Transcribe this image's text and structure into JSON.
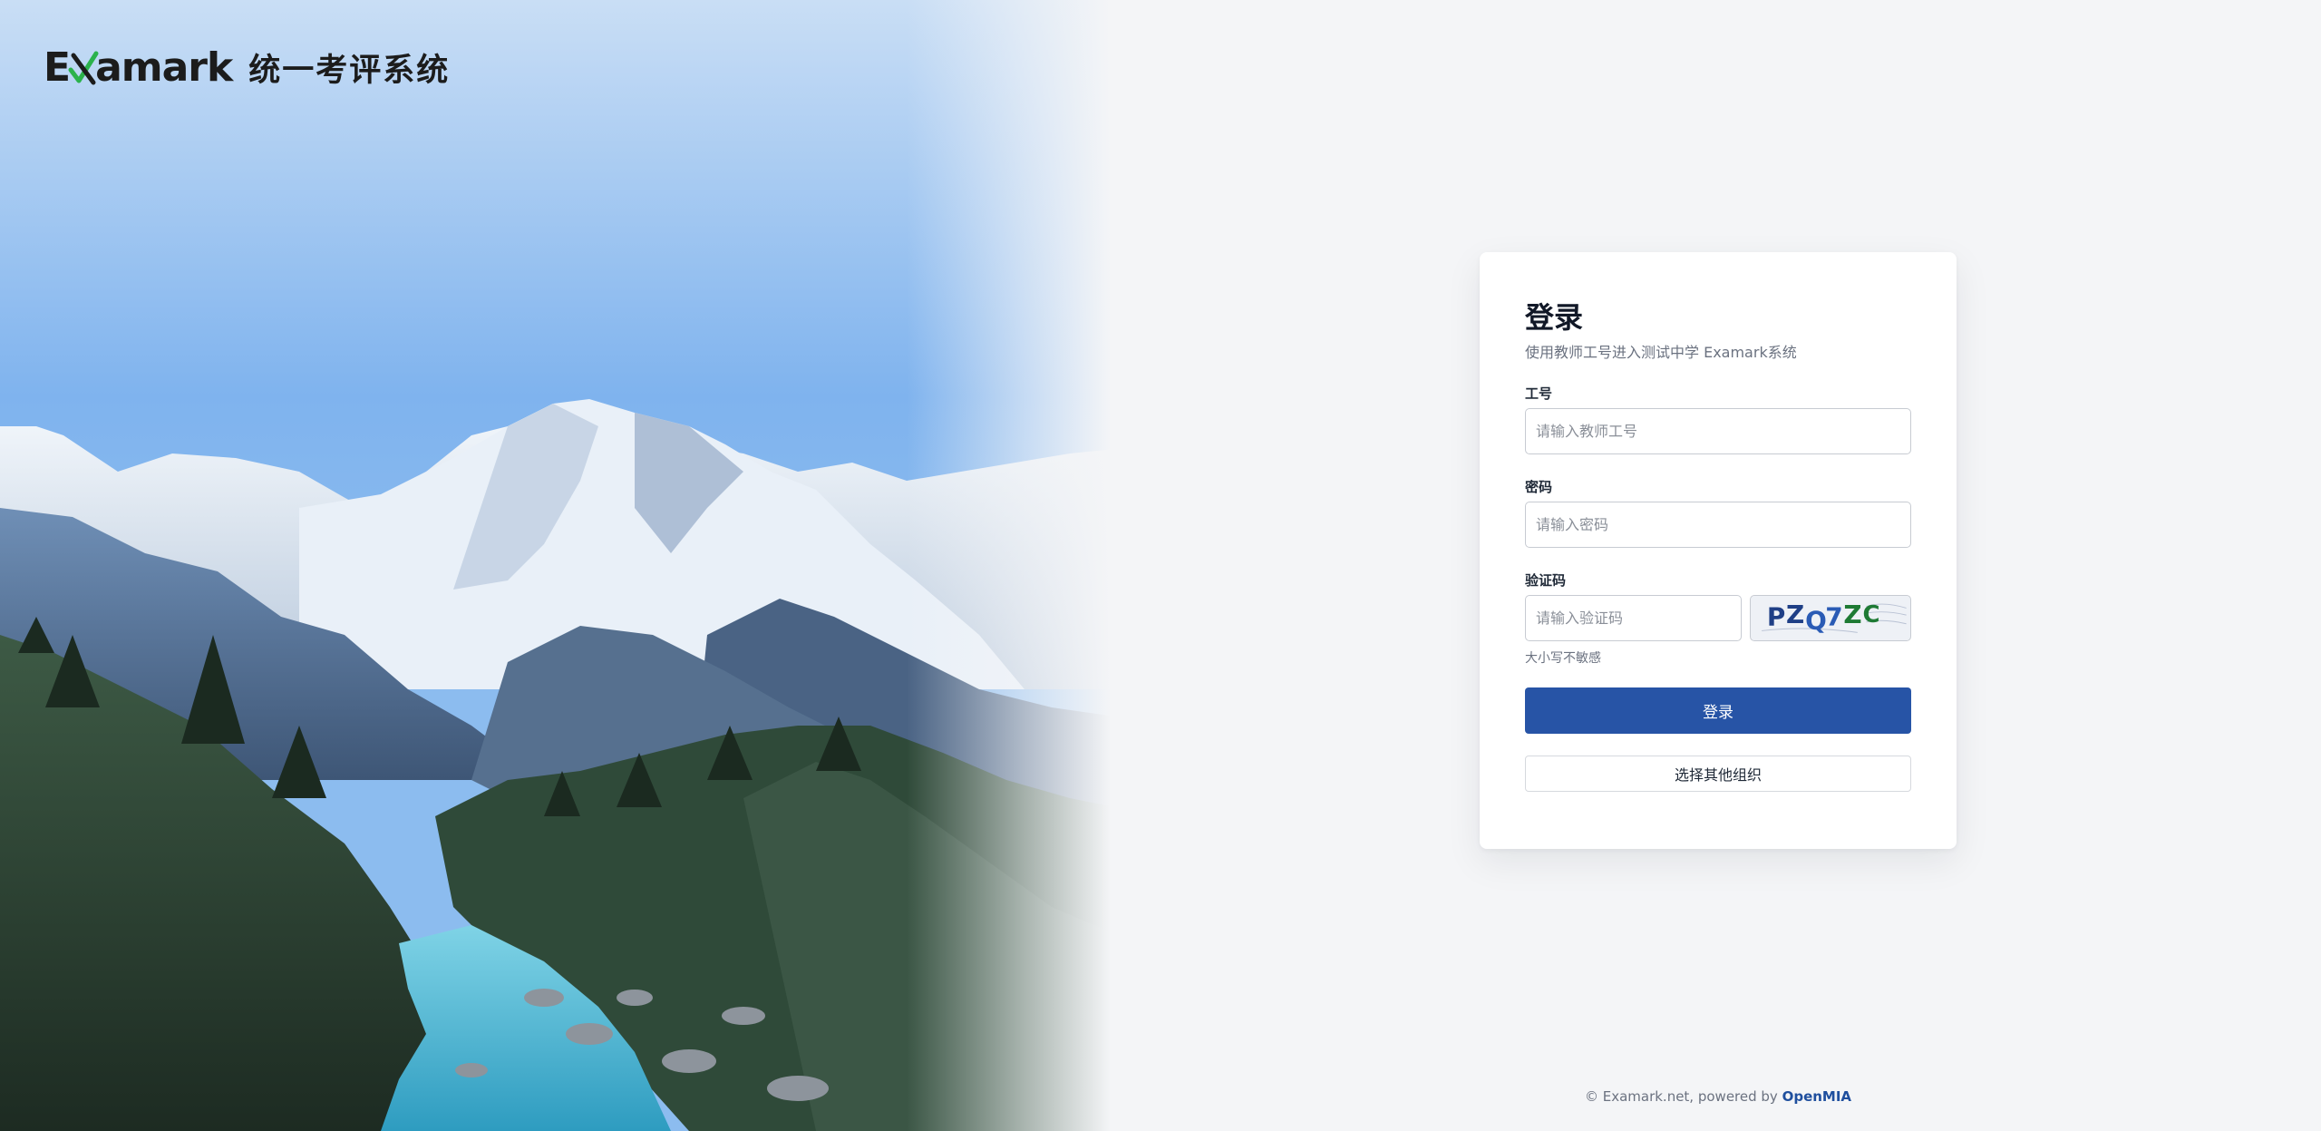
{
  "brand": {
    "logo_text": "Examark",
    "system_name": "统一考评系统"
  },
  "login": {
    "title": "登录",
    "subtitle": "使用教师工号进入测试中学 Examark系统",
    "id_label": "工号",
    "id_placeholder": "请输入教师工号",
    "password_label": "密码",
    "password_placeholder": "请输入密码",
    "captcha_label": "验证码",
    "captcha_placeholder": "请输入验证码",
    "captcha_text": "PZQ7ZC",
    "captcha_hint": "大小写不敏感",
    "submit_label": "登录",
    "switch_org_label": "选择其他组织"
  },
  "footer": {
    "prefix": "© Examark.net, powered by ",
    "link_text": "OpenMIA"
  },
  "colors": {
    "primary": "#2754a6",
    "page_bg": "#f4f5f7",
    "logo_check": "#2bb24c"
  }
}
